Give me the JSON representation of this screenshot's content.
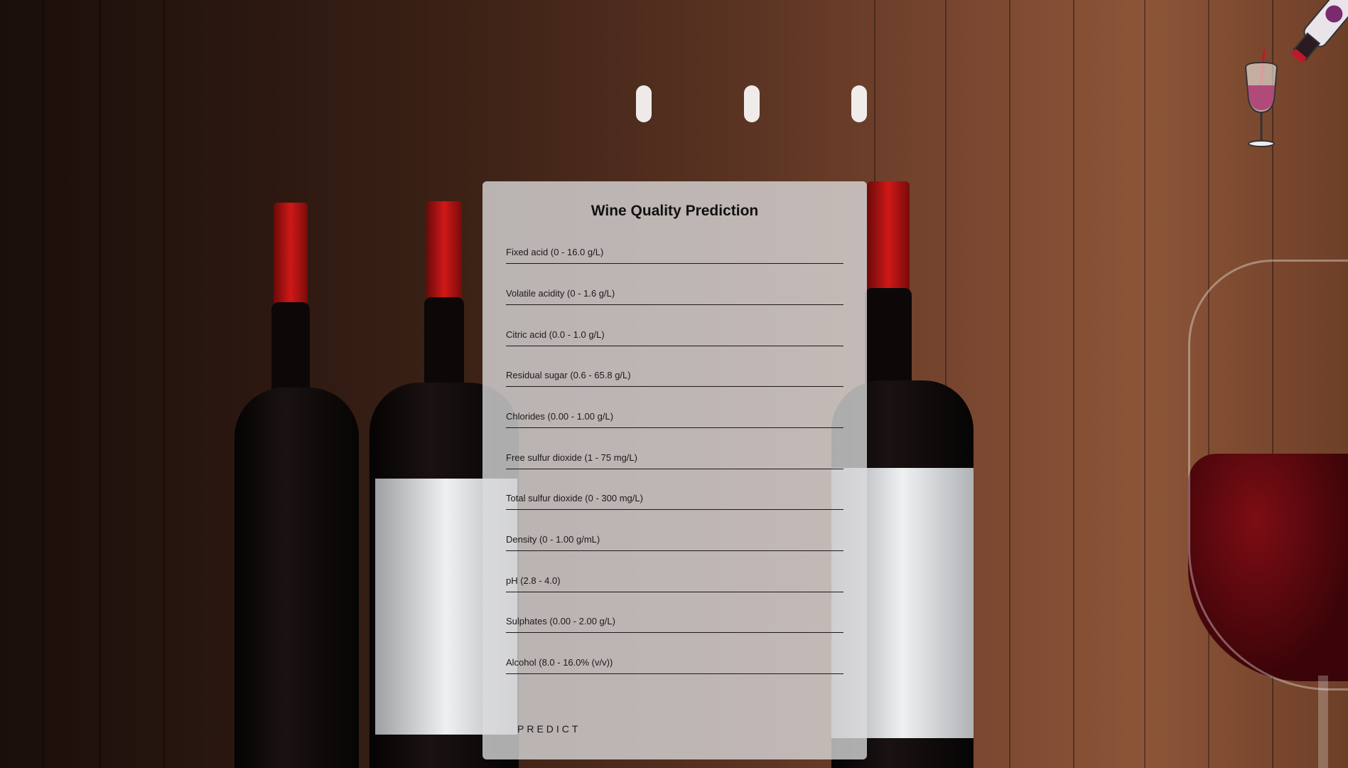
{
  "form": {
    "title": "Wine Quality Prediction",
    "fields": [
      {
        "placeholder": "Fixed acid (0 - 16.0 g/L)",
        "value": ""
      },
      {
        "placeholder": "Volatile acidity (0 - 1.6 g/L)",
        "value": ""
      },
      {
        "placeholder": "Citric acid (0.0 - 1.0 g/L)",
        "value": ""
      },
      {
        "placeholder": "Residual sugar (0.6 - 65.8 g/L)",
        "value": ""
      },
      {
        "placeholder": "Chlorides (0.00 - 1.00 g/L)",
        "value": ""
      },
      {
        "placeholder": "Free sulfur dioxide (1 - 75 mg/L)",
        "value": ""
      },
      {
        "placeholder": "Total sulfur dioxide (0 - 300 mg/L)",
        "value": ""
      },
      {
        "placeholder": "Density (0 - 1.00 g/mL)",
        "value": ""
      },
      {
        "placeholder": "pH (2.8 - 4.0)",
        "value": ""
      },
      {
        "placeholder": "Sulphates (0.00 - 2.00 g/L)",
        "value": ""
      },
      {
        "placeholder": "Alcohol (8.0 - 16.0% (v/v))",
        "value": ""
      }
    ],
    "predict_label": "PREDICT"
  },
  "colors": {
    "card_background": "#dcdcde",
    "text": "#111111",
    "wine_red": "#7d0d14"
  },
  "icons": {
    "logo": "wine-bottle-pouring-into-glass-icon"
  }
}
